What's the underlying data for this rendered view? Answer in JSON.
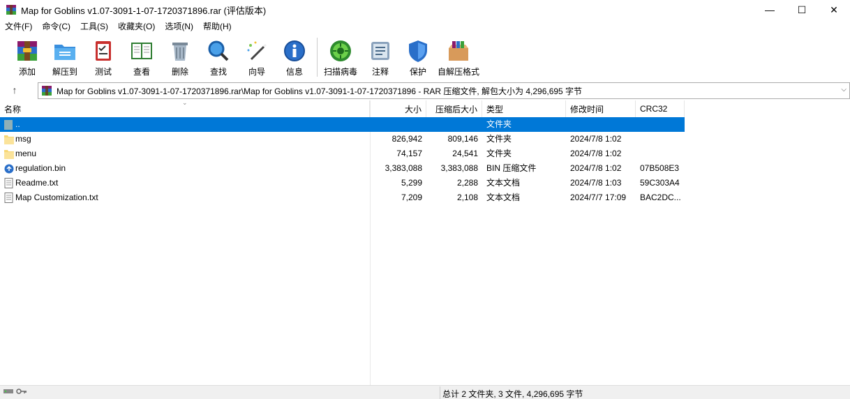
{
  "window": {
    "title": "Map for Goblins v1.07-3091-1-07-1720371896.rar (评估版本)",
    "minimize": "—",
    "maximize": "☐",
    "close": "✕"
  },
  "menu": [
    "文件(F)",
    "命令(C)",
    "工具(S)",
    "收藏夹(O)",
    "选项(N)",
    "帮助(H)"
  ],
  "toolbar": {
    "add": "添加",
    "extract": "解压到",
    "test": "测试",
    "view": "查看",
    "delete": "删除",
    "find": "查找",
    "wizard": "向导",
    "info": "信息",
    "scan": "扫描病毒",
    "comment": "注释",
    "protect": "保护",
    "sfx": "自解压格式"
  },
  "address": {
    "up": "↑",
    "path": "Map for Goblins v1.07-3091-1-07-1720371896.rar\\Map for Goblins v1.07-3091-1-07-1720371896 - RAR 压缩文件, 解包大小为 4,296,695 字节",
    "dropdown": "⌵"
  },
  "columns": {
    "name": "名称",
    "size": "大小",
    "packed": "压缩后大小",
    "type": "类型",
    "modified": "修改时间",
    "crc": "CRC32"
  },
  "files": [
    {
      "name": "..",
      "size": "",
      "packed": "",
      "type": "文件夹",
      "modified": "",
      "crc": "",
      "icon": "parent-folder-icon"
    },
    {
      "name": "msg",
      "size": "826,942",
      "packed": "809,146",
      "type": "文件夹",
      "modified": "2024/7/8 1:02",
      "crc": "",
      "icon": "folder-icon"
    },
    {
      "name": "menu",
      "size": "74,157",
      "packed": "24,541",
      "type": "文件夹",
      "modified": "2024/7/8 1:02",
      "crc": "",
      "icon": "folder-icon"
    },
    {
      "name": "regulation.bin",
      "size": "3,383,088",
      "packed": "3,383,088",
      "type": "BIN 压缩文件",
      "modified": "2024/7/8 1:02",
      "crc": "07B508E3",
      "icon": "bin-file-icon"
    },
    {
      "name": "Readme.txt",
      "size": "5,299",
      "packed": "2,288",
      "type": "文本文档",
      "modified": "2024/7/8 1:03",
      "crc": "59C303A4",
      "icon": "text-file-icon"
    },
    {
      "name": "Map Customization.txt",
      "size": "7,209",
      "packed": "2,108",
      "type": "文本文档",
      "modified": "2024/7/7 17:09",
      "crc": "BAC2DC...",
      "icon": "text-file-icon"
    }
  ],
  "status": {
    "summary": "总计 2 文件夹, 3 文件, 4,296,695 字节"
  },
  "colors": {
    "selection": "#0078d7",
    "folder": "#f7d774",
    "statusbar": "#f0f0f0"
  }
}
